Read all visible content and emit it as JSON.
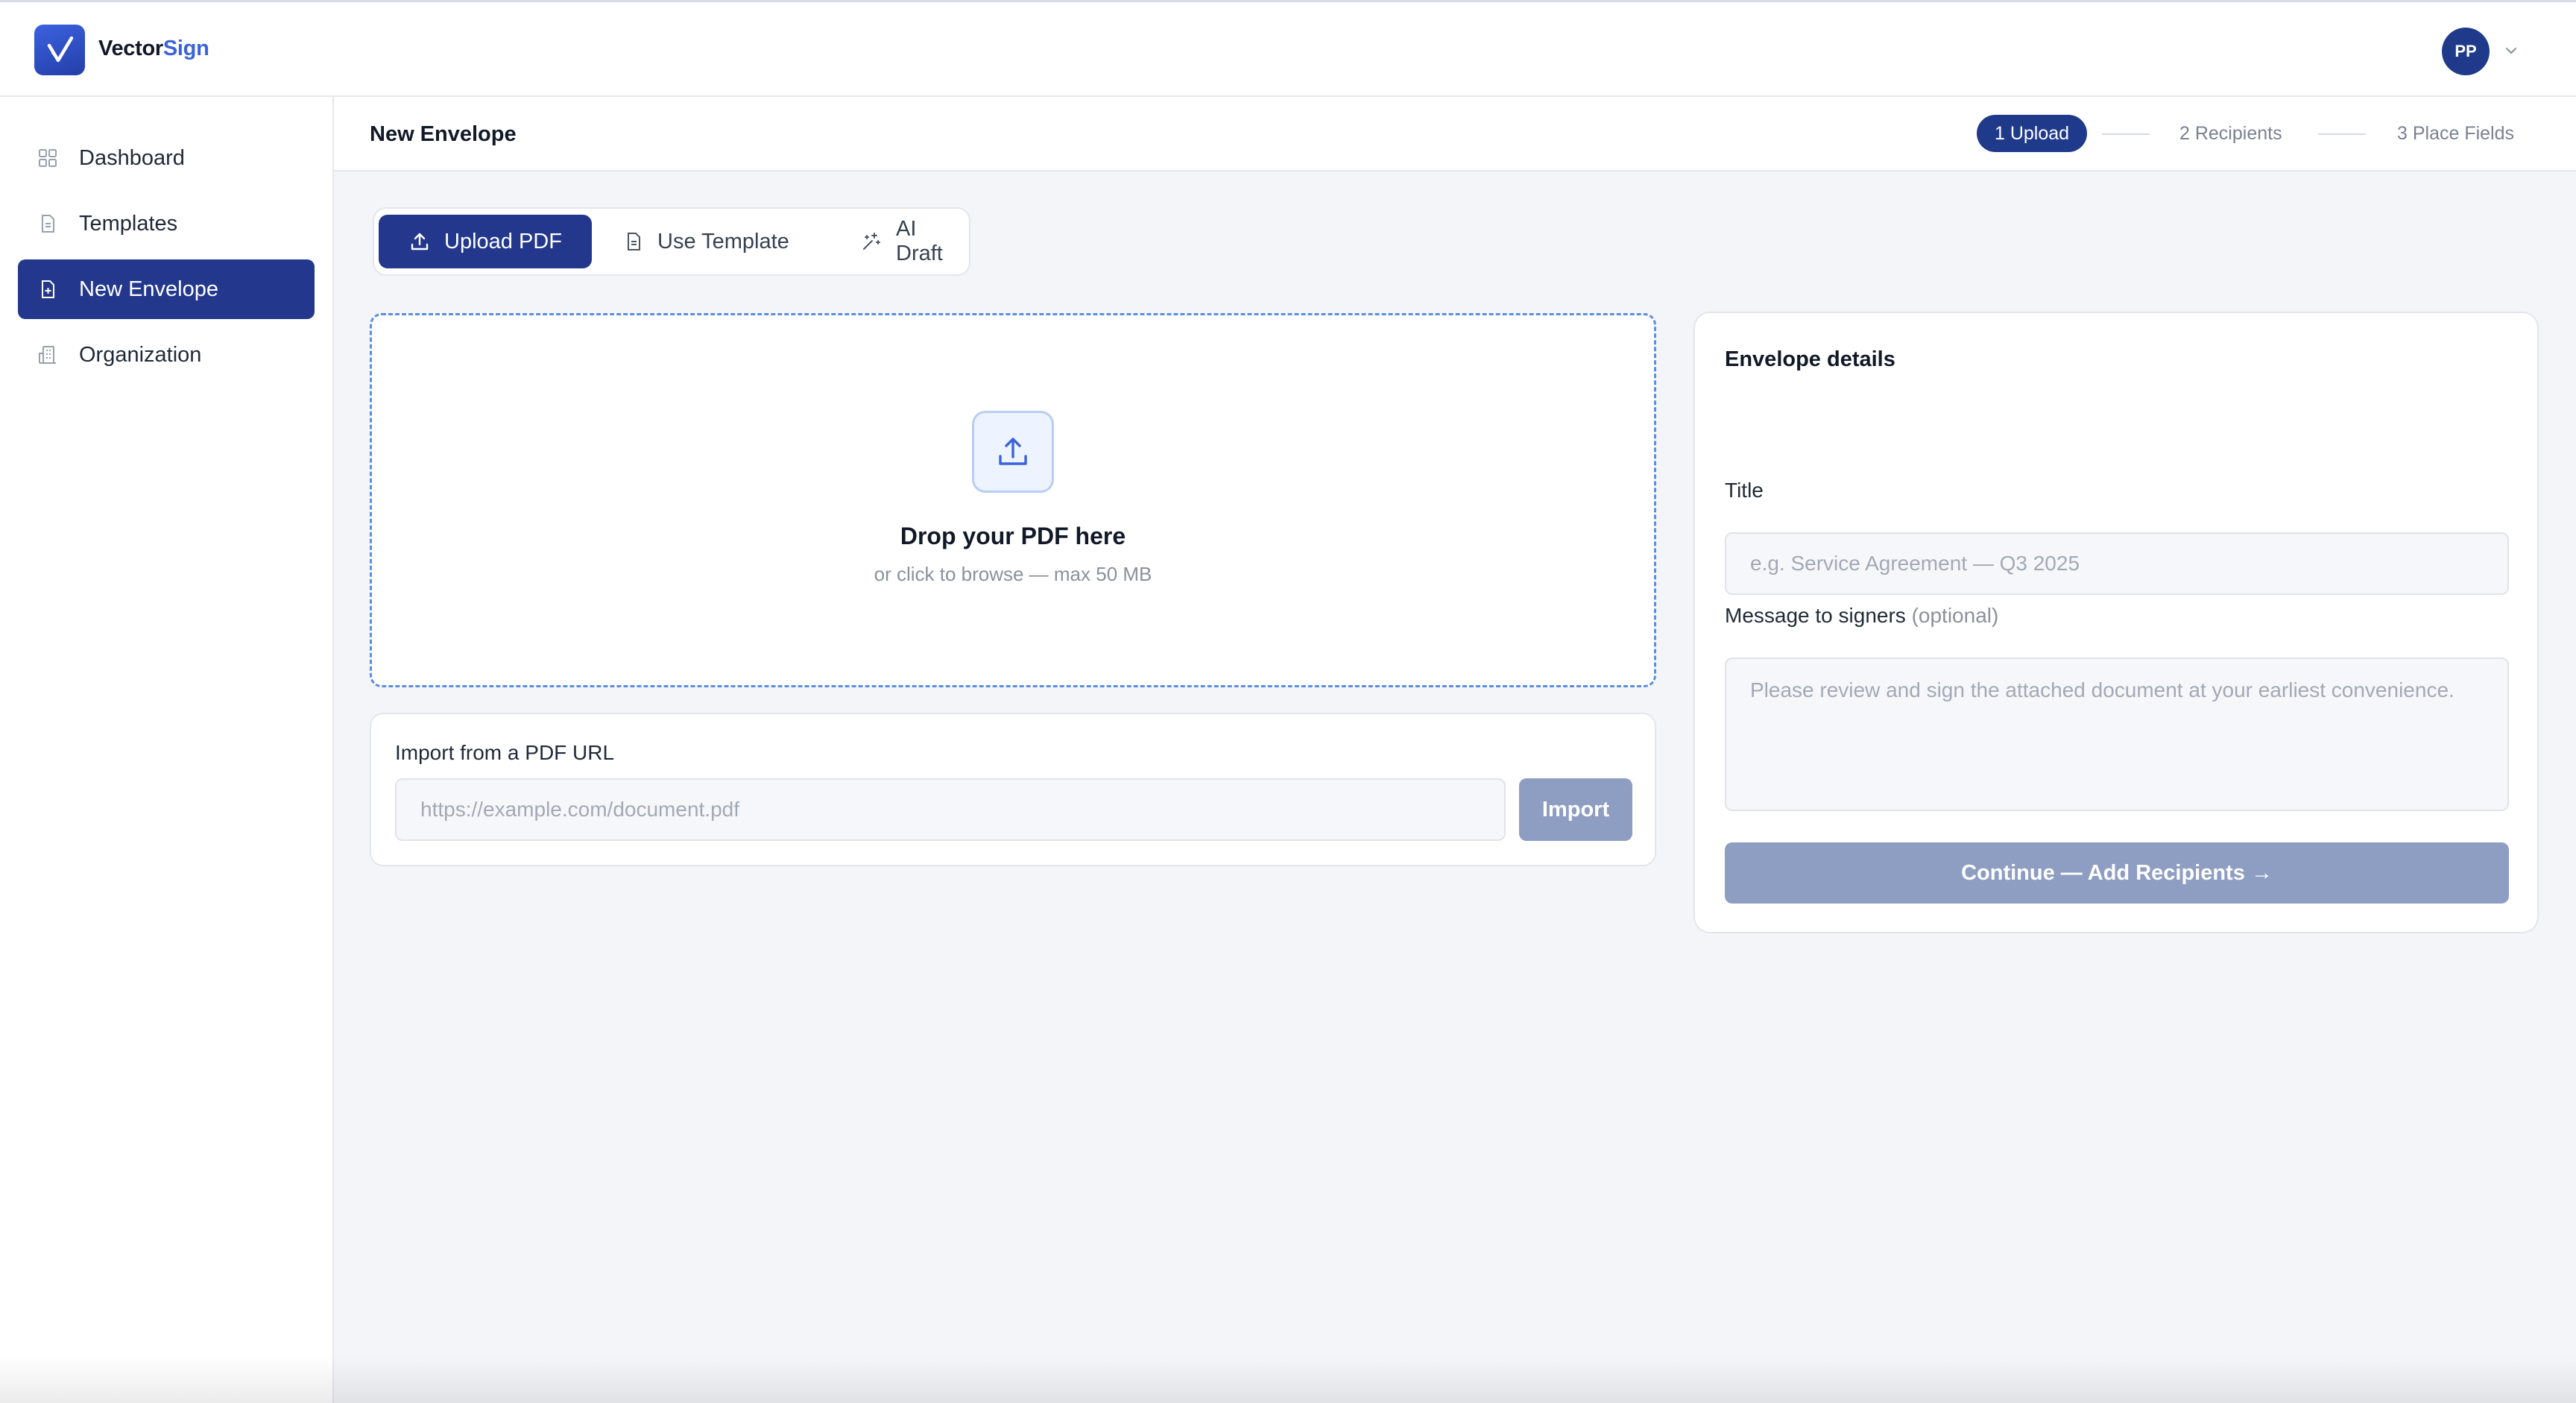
{
  "app": {
    "brand_prefix": "Vector",
    "brand_suffix": "Sign",
    "logo_icon": "checkmark-logo-icon",
    "avatar_initials": "PP"
  },
  "sidebar": {
    "items": [
      {
        "label": "Dashboard",
        "icon": "grid-icon",
        "active": false
      },
      {
        "label": "Templates",
        "icon": "document-icon",
        "active": false
      },
      {
        "label": "New Envelope",
        "icon": "file-plus-icon",
        "active": true
      },
      {
        "label": "Organization",
        "icon": "building-icon",
        "active": false
      }
    ]
  },
  "header": {
    "title": "New Envelope",
    "steps": [
      {
        "label": "1  Upload",
        "active": true
      },
      {
        "label": "2  Recipients",
        "active": false
      },
      {
        "label": "3  Place Fields",
        "active": false
      }
    ]
  },
  "tabs": [
    {
      "label": "Upload PDF",
      "icon": "upload-icon",
      "active": true
    },
    {
      "label": "Use Template",
      "icon": "document-icon",
      "active": false
    },
    {
      "label": "AI Draft",
      "icon": "sparkle-icon",
      "active": false
    }
  ],
  "dropzone": {
    "title": "Drop your PDF here",
    "subtitle": "or click to browse — max 50 MB"
  },
  "import": {
    "label": "Import from a PDF URL",
    "placeholder": "https://example.com/document.pdf",
    "value": "",
    "button": "Import"
  },
  "details": {
    "title": "Envelope details",
    "title_label": "Title",
    "title_placeholder": "e.g. Service Agreement — Q3 2025",
    "message_label": "Message to signers",
    "message_optional": "(optional)",
    "message_placeholder": "Please review and sign the attached document at your earliest convenience.",
    "continue_button": "Continue — Add Recipients →"
  },
  "colors": {
    "primary": "#23388c",
    "accent": "#3a63d8",
    "disabled_button": "#8e9dc2",
    "page_bg": "#f4f5f9"
  }
}
